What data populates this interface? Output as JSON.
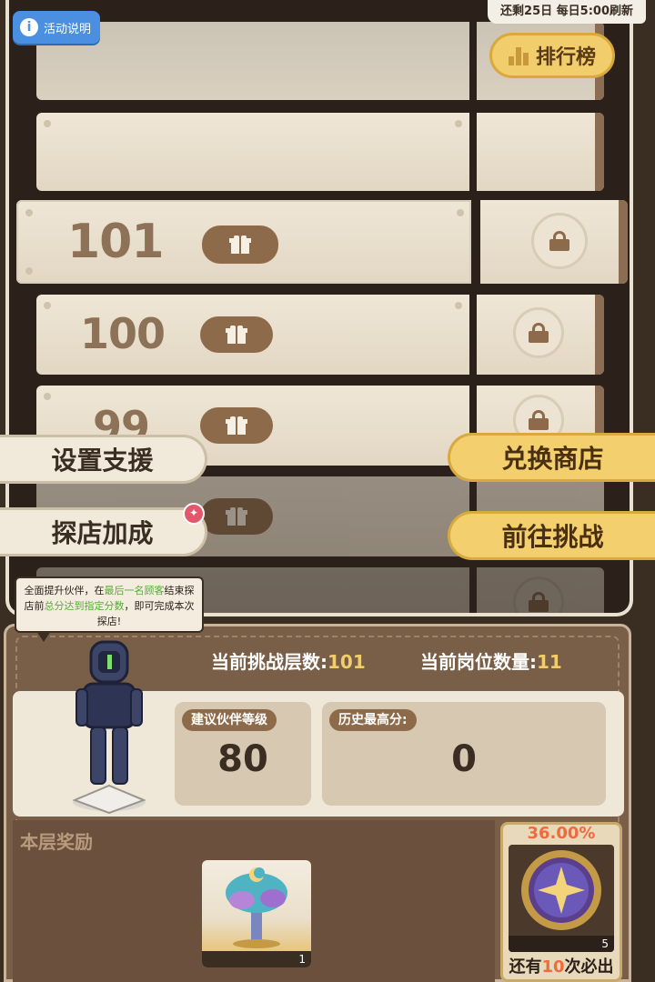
{
  "header": {
    "info_label": "活动说明",
    "timer_text": "还剩25日 每日5:00刷新",
    "ranking_label": "排行榜"
  },
  "floors": [
    {
      "number": "",
      "locked": false
    },
    {
      "number": "",
      "locked": false
    },
    {
      "number": "101",
      "locked": true,
      "current": true
    },
    {
      "number": "100",
      "locked": true
    },
    {
      "number": "99",
      "locked": true
    }
  ],
  "side_buttons": {
    "setup_support": "设置支援",
    "shop_bonus": "探店加成",
    "exchange_shop": "兑换商店",
    "go_challenge": "前往挑战"
  },
  "bubble": {
    "part1": "全面提升伙伴，在",
    "highlight1": "最后一名顾客",
    "part2": "结束探店前",
    "highlight2": "总分达到指定分数",
    "part3": "，即可完成本次探店!"
  },
  "stats": {
    "floor_label": "当前挑战层数:",
    "floor_value": "101",
    "slots_label": "当前岗位数量:",
    "slots_value": "11"
  },
  "cards": {
    "recommended_label": "建议伙伴等级",
    "recommended_value": "80",
    "best_label": "历史最高分:",
    "best_value": "0"
  },
  "reward": {
    "title": "本层奖励",
    "item_count": "1"
  },
  "guarantee": {
    "percent": "36.00%",
    "count": "5",
    "footer_prefix": "还有",
    "footer_value": "10",
    "footer_suffix": "次必出"
  },
  "colors": {
    "accent_gold": "#f2cd6c",
    "highlight_orange": "#ef6a3c",
    "highlight_green": "#58a93a"
  }
}
